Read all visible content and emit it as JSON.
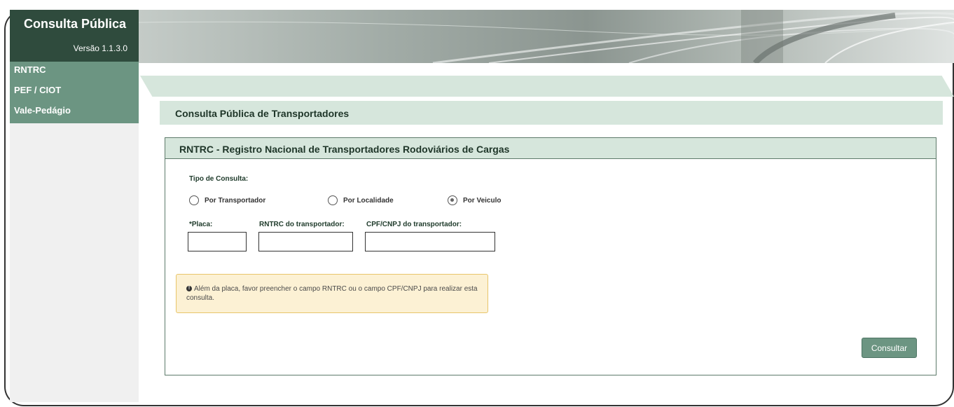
{
  "brand": {
    "title": "Consulta Pública",
    "version": "Versão 1.1.3.0"
  },
  "nav": {
    "items": [
      {
        "label": "RNTRC"
      },
      {
        "label": "PEF / CIOT"
      },
      {
        "label": "Vale-Pedágio"
      }
    ]
  },
  "section_title": "Consulta Pública de Transportadores",
  "panel": {
    "title": "RNTRC - Registro Nacional de Transportadores Rodoviários de Cargas",
    "tipo_label": "Tipo de Consulta:",
    "options": [
      {
        "label": "Por Transportador",
        "selected": false
      },
      {
        "label": "Por Localidade",
        "selected": false
      },
      {
        "label": "Por Veiculo",
        "selected": true
      }
    ],
    "fields": [
      {
        "label": "*Placa:",
        "value": ""
      },
      {
        "label": "RNTRC do transportador:",
        "value": ""
      },
      {
        "label": "CPF/CNPJ do transportador:",
        "value": ""
      }
    ],
    "alert": "Além da placa, favor preencher o campo RNTRC ou o campo CPF/CNPJ para realizar esta consulta.",
    "submit_label": "Consultar"
  },
  "colors": {
    "dark_green": "#2f4b3d",
    "nav_green": "#6c9582",
    "light_green": "#d6e6dc",
    "alert_bg": "#fcf1d4"
  }
}
